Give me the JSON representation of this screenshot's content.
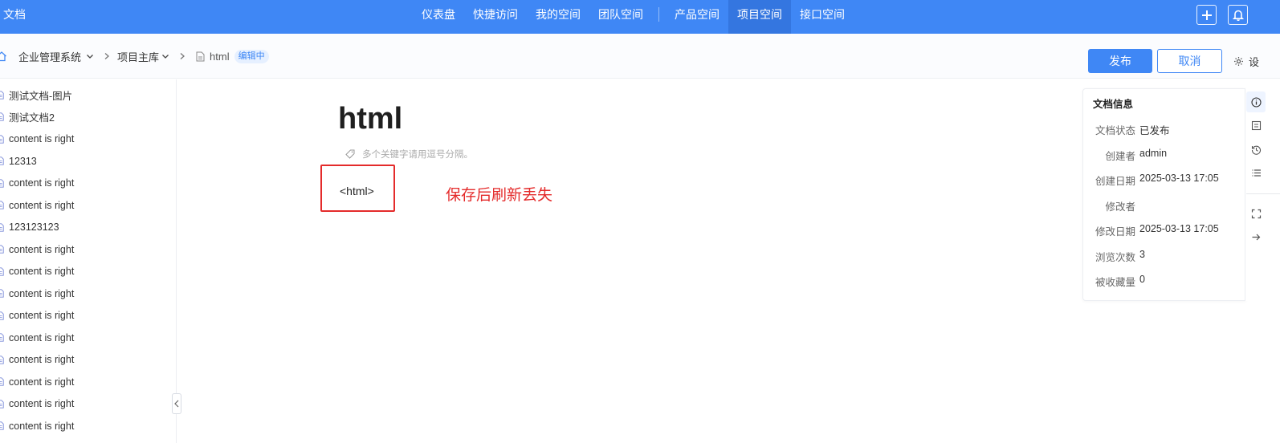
{
  "app": {
    "title": "文档"
  },
  "nav": {
    "items": [
      {
        "label": "仪表盘"
      },
      {
        "label": "快捷访问"
      },
      {
        "label": "我的空间"
      },
      {
        "label": "团队空间"
      },
      {
        "label": "产品空间"
      },
      {
        "label": "项目空间",
        "active": true
      },
      {
        "label": "接口空间"
      }
    ]
  },
  "breadcrumb": {
    "items": [
      "企业管理系统",
      "项目主库",
      "html"
    ],
    "status_badge": "编辑中"
  },
  "actions": {
    "publish_label": "发布",
    "cancel_label": "取消",
    "settings_label": "设"
  },
  "sidebar": {
    "items": [
      "测试文档-图片",
      "测试文档2",
      "content is right",
      "12313",
      "content is right",
      "content is right",
      "123123123",
      "content is right",
      "content is right",
      "content is right",
      "content is right",
      "content is right",
      "content is right",
      "content is right",
      "content is right",
      "content is right"
    ]
  },
  "editor": {
    "title": "html",
    "keywords_placeholder": "多个关键字请用逗号分隔。",
    "content": "<html>",
    "annotation": "保存后刷新丢失"
  },
  "info_panel": {
    "title": "文档信息",
    "rows": [
      {
        "label": "文档状态",
        "value": "已发布"
      },
      {
        "label": "创建者",
        "value": "admin"
      },
      {
        "label": "创建日期",
        "value": "2025-03-13 17:05"
      },
      {
        "label": "修改者",
        "value": ""
      },
      {
        "label": "修改日期",
        "value": "2025-03-13 17:05"
      },
      {
        "label": "浏览次数",
        "value": "3"
      },
      {
        "label": "被收藏量",
        "value": "0"
      }
    ]
  },
  "colors": {
    "primary": "#3f87f5",
    "annotation_red": "#e42b2b"
  },
  "icons": [
    "home-icon",
    "chevron-down-icon",
    "chevron-right-icon",
    "doc-icon",
    "plus-icon",
    "bell-icon",
    "settings-gear-icon",
    "tag-icon",
    "info-icon",
    "outline-icon",
    "history-icon",
    "list-icon",
    "fullscreen-icon",
    "arrow-right-icon",
    "collapse-left-icon"
  ]
}
